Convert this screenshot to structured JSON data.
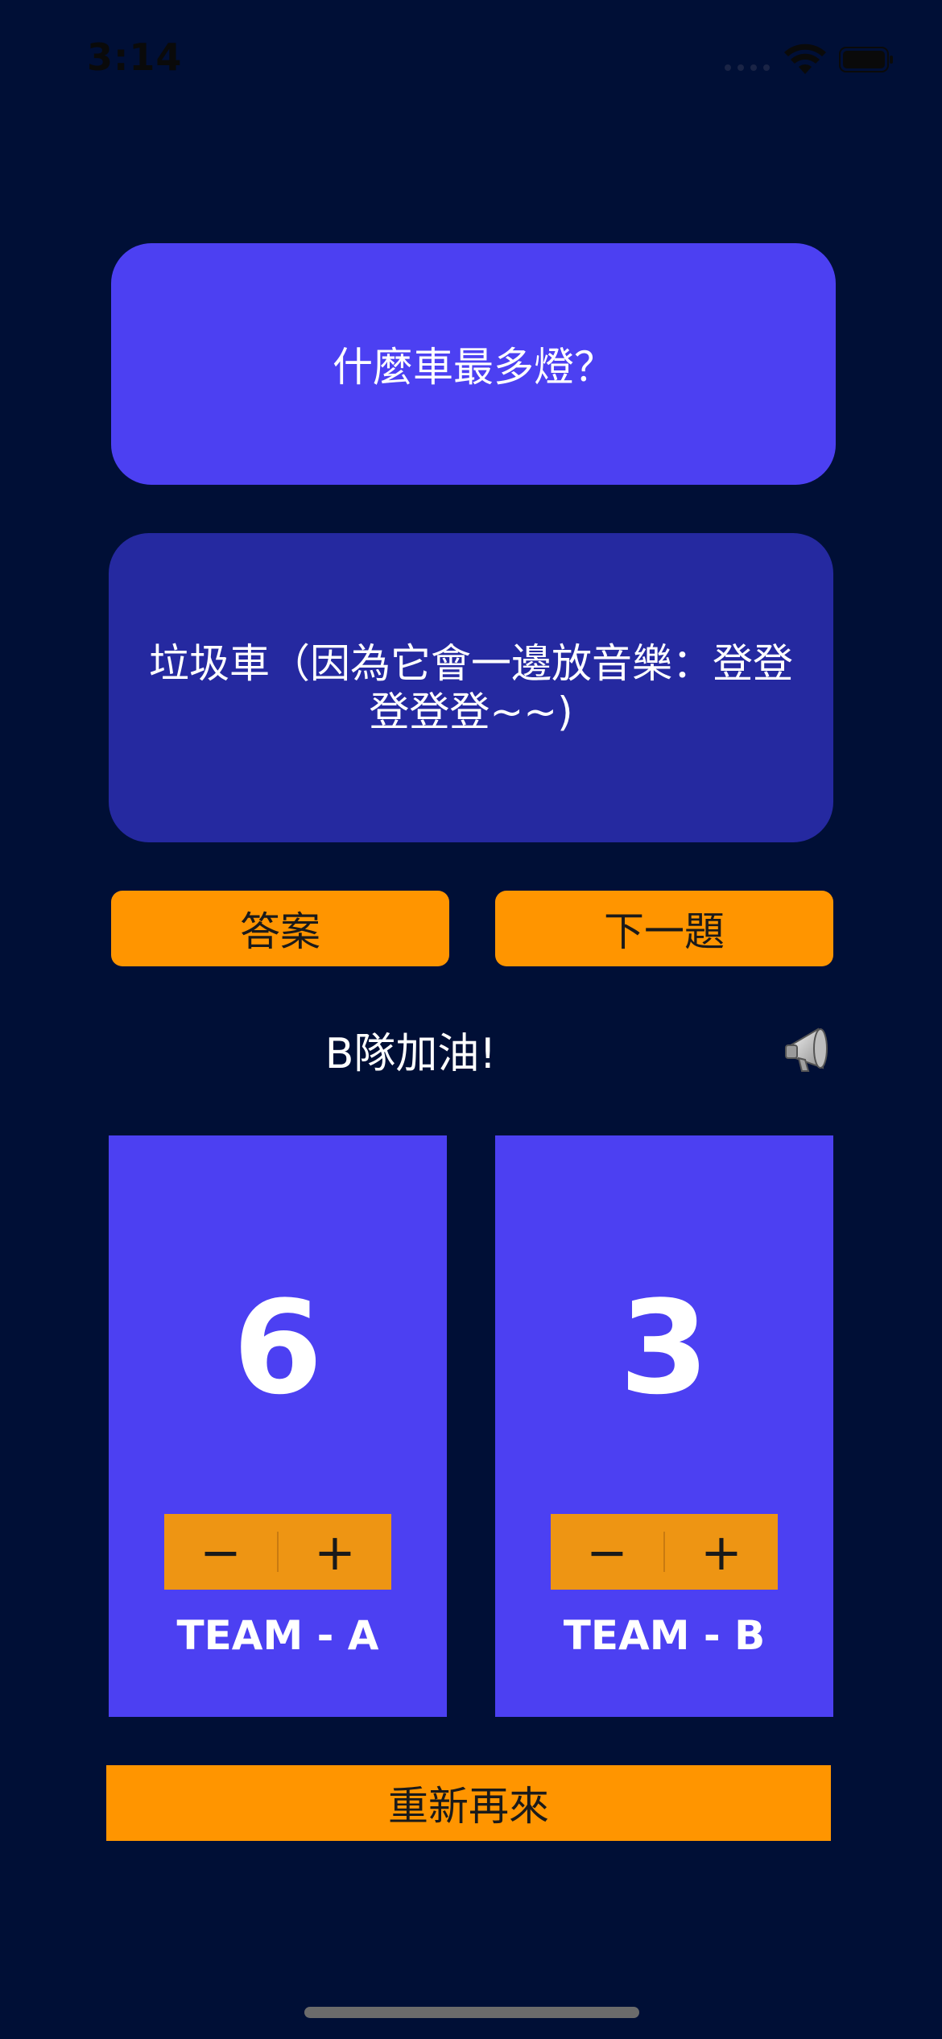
{
  "status_bar": {
    "time": "3:14",
    "icons": [
      "signal-dots-icon",
      "wifi-icon",
      "battery-icon"
    ]
  },
  "question": {
    "text": "什麼車最多燈？"
  },
  "answer": {
    "text": "垃圾車（因為它會一邊放音樂：登登登登登~~)"
  },
  "buttons": {
    "answer_label": "答案",
    "next_label": "下一題",
    "restart_label": "重新再來"
  },
  "cheer": {
    "text": "B隊加油!",
    "icon": "megaphone-icon"
  },
  "teams": [
    {
      "name": "TEAM - A",
      "score": "6",
      "minus": "−",
      "plus": "+"
    },
    {
      "name": "TEAM - B",
      "score": "3",
      "minus": "−",
      "plus": "+"
    }
  ],
  "colors": {
    "background": "#000f36",
    "card_question": "#4c40f2",
    "card_answer": "#2529a0",
    "accent_orange": "#ff9500",
    "team_panel": "#4c40f2",
    "stepper": "#ee9513"
  }
}
